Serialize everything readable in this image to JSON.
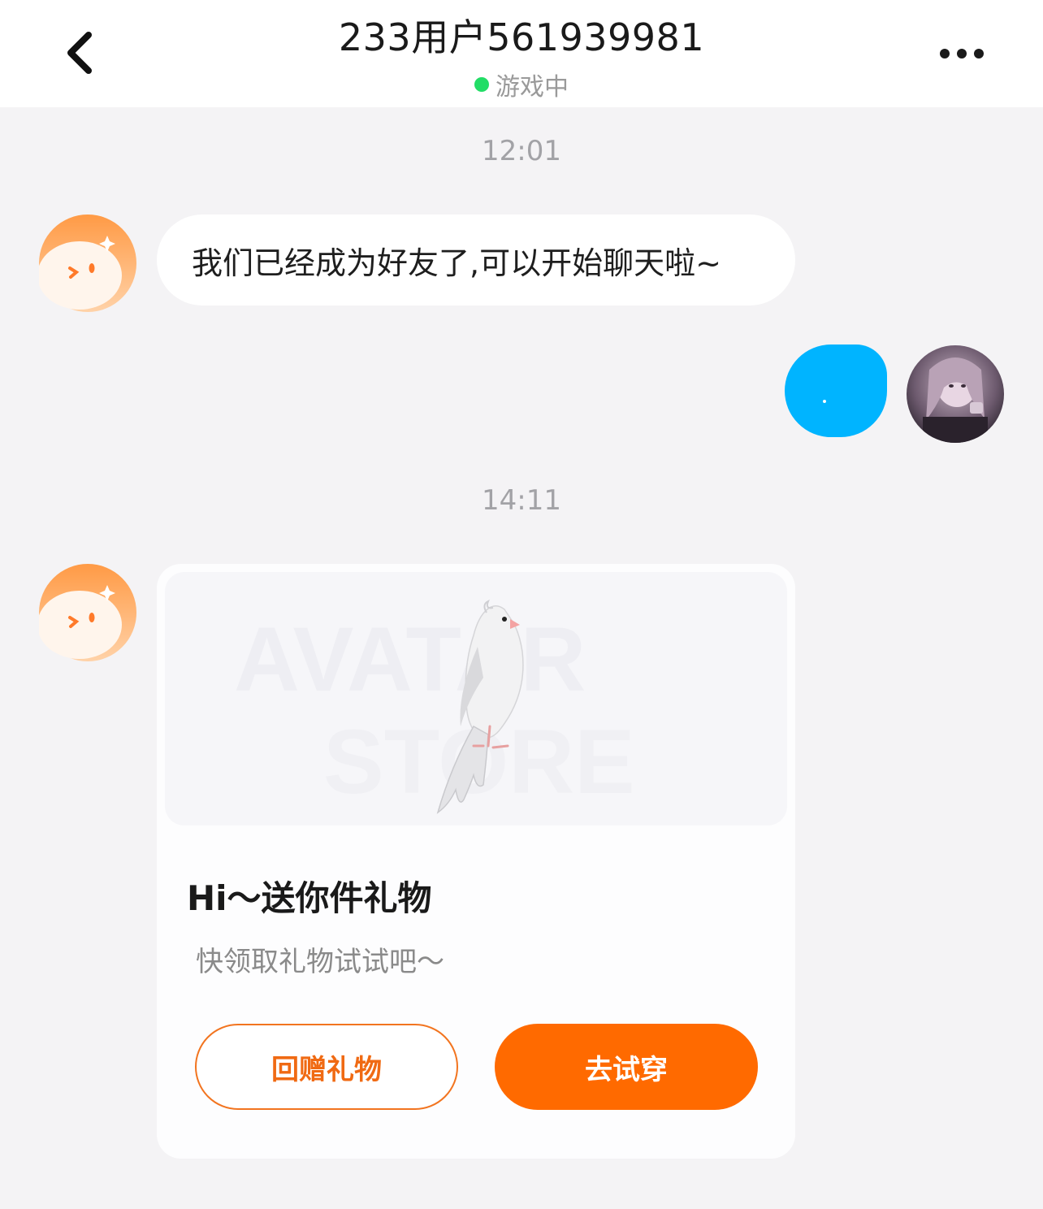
{
  "header": {
    "title": "233用户561939981",
    "status": "游戏中",
    "status_color": "#22dd66",
    "back_icon": "chevron-left-icon",
    "more_icon": "more-horizontal-icon"
  },
  "messages": [
    {
      "type": "timestamp",
      "text": "12:01"
    },
    {
      "type": "incoming_text",
      "text": "我们已经成为好友了,可以开始聊天啦~"
    },
    {
      "type": "outgoing_text",
      "text": "."
    },
    {
      "type": "timestamp",
      "text": "14:11"
    }
  ],
  "gift_card": {
    "watermark_line1": "AVATAR",
    "watermark_line2": "STORE",
    "title": "Hi～送你件礼物",
    "subtitle": "快领取礼物试试吧～",
    "return_button": "回赠礼物",
    "try_button": "去试穿",
    "accent_color": "#ff6a00"
  }
}
